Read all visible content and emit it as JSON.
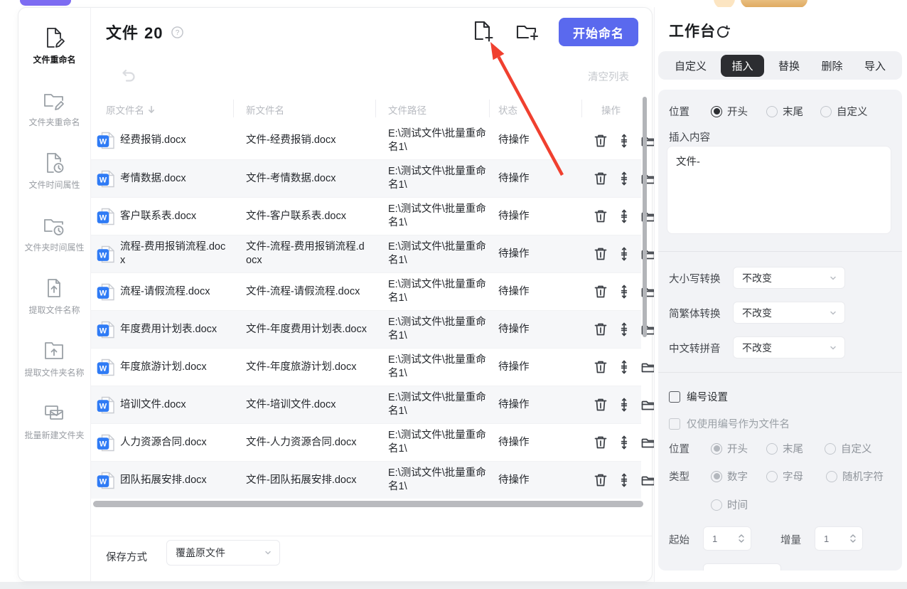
{
  "page": {
    "title_label": "文件",
    "file_count": "20",
    "clear_list": "清空列表",
    "start_button": "开始命名"
  },
  "sidebar": {
    "items": [
      {
        "label": "文件重命名",
        "icon": "file-edit-icon",
        "active": true
      },
      {
        "label": "文件夹重命名",
        "icon": "folder-edit-icon",
        "active": false
      },
      {
        "label": "文件时间属性",
        "icon": "file-clock-icon",
        "active": false
      },
      {
        "label": "文件夹时间属性",
        "icon": "folder-clock-icon",
        "active": false
      },
      {
        "label": "提取文件名称",
        "icon": "file-extract-icon",
        "active": false
      },
      {
        "label": "提取文件夹名称",
        "icon": "folder-extract-icon",
        "active": false
      },
      {
        "label": "批量新建文件夹",
        "icon": "new-folders-icon",
        "active": false
      }
    ]
  },
  "table": {
    "headers": [
      "原文件名",
      "新文件名",
      "文件路径",
      "状态",
      "操作"
    ],
    "op_icons": [
      "delete-icon",
      "move-icon",
      "open-folder-icon"
    ],
    "rows": [
      {
        "original": "经费报销.docx",
        "new_name": "文件-经费报销.docx",
        "path": "E:\\测试文件\\批量重命名1\\",
        "status": "待操作"
      },
      {
        "original": "考情数据.docx",
        "new_name": "文件-考情数据.docx",
        "path": "E:\\测试文件\\批量重命名1\\",
        "status": "待操作"
      },
      {
        "original": "客户联系表.docx",
        "new_name": "文件-客户联系表.docx",
        "path": "E:\\测试文件\\批量重命名1\\",
        "status": "待操作"
      },
      {
        "original": "流程-费用报销流程.docx",
        "new_name": "文件-流程-费用报销流程.docx",
        "path": "E:\\测试文件\\批量重命名1\\",
        "status": "待操作"
      },
      {
        "original": "流程-请假流程.docx",
        "new_name": "文件-流程-请假流程.docx",
        "path": "E:\\测试文件\\批量重命名1\\",
        "status": "待操作"
      },
      {
        "original": "年度费用计划表.docx",
        "new_name": "文件-年度费用计划表.docx",
        "path": "E:\\测试文件\\批量重命名1\\",
        "status": "待操作"
      },
      {
        "original": "年度旅游计划.docx",
        "new_name": "文件-年度旅游计划.docx",
        "path": "E:\\测试文件\\批量重命名1\\",
        "status": "待操作"
      },
      {
        "original": "培训文件.docx",
        "new_name": "文件-培训文件.docx",
        "path": "E:\\测试文件\\批量重命名1\\",
        "status": "待操作"
      },
      {
        "original": "人力资源合同.docx",
        "new_name": "文件-人力资源合同.docx",
        "path": "E:\\测试文件\\批量重命名1\\",
        "status": "待操作"
      },
      {
        "original": "团队拓展安排.docx",
        "new_name": "文件-团队拓展安排.docx",
        "path": "E:\\测试文件\\批量重命名1\\",
        "status": "待操作"
      }
    ]
  },
  "footer": {
    "save_label": "保存方式",
    "save_value": "覆盖原文件"
  },
  "workbench": {
    "title": "工作台",
    "tabs": [
      "自定义",
      "插入",
      "替换",
      "删除",
      "导入"
    ],
    "active_tab": "插入",
    "insert_panel": {
      "position_label": "位置",
      "position_options": [
        "开头",
        "末尾",
        "自定义"
      ],
      "position_selected": "开头",
      "content_label": "插入内容",
      "content_value": "文件-",
      "case_label": "大小写转换",
      "case_value": "不改变",
      "tradsimp_label": "简繁体转换",
      "tradsimp_value": "不改变",
      "pinyin_label": "中文转拼音",
      "pinyin_value": "不改变"
    },
    "numbering": {
      "enable_label": "编号设置",
      "only_number_label": "仅使用编号作为文件名",
      "position_label": "位置",
      "position_options": [
        "开头",
        "末尾",
        "自定义"
      ],
      "position_selected": "开头",
      "type_label": "类型",
      "type_options": [
        "数字",
        "字母",
        "随机字符",
        "时间"
      ],
      "type_selected": "数字",
      "start_label": "起始",
      "start_value": "1",
      "increment_label": "增量",
      "increment_value": "1"
    }
  },
  "colors": {
    "accent_blue": "#5a69ee",
    "word_icon_blue": "#2f7bf5",
    "annotation_red": "#f0402f",
    "tab_active_bg": "#2c2d31"
  }
}
